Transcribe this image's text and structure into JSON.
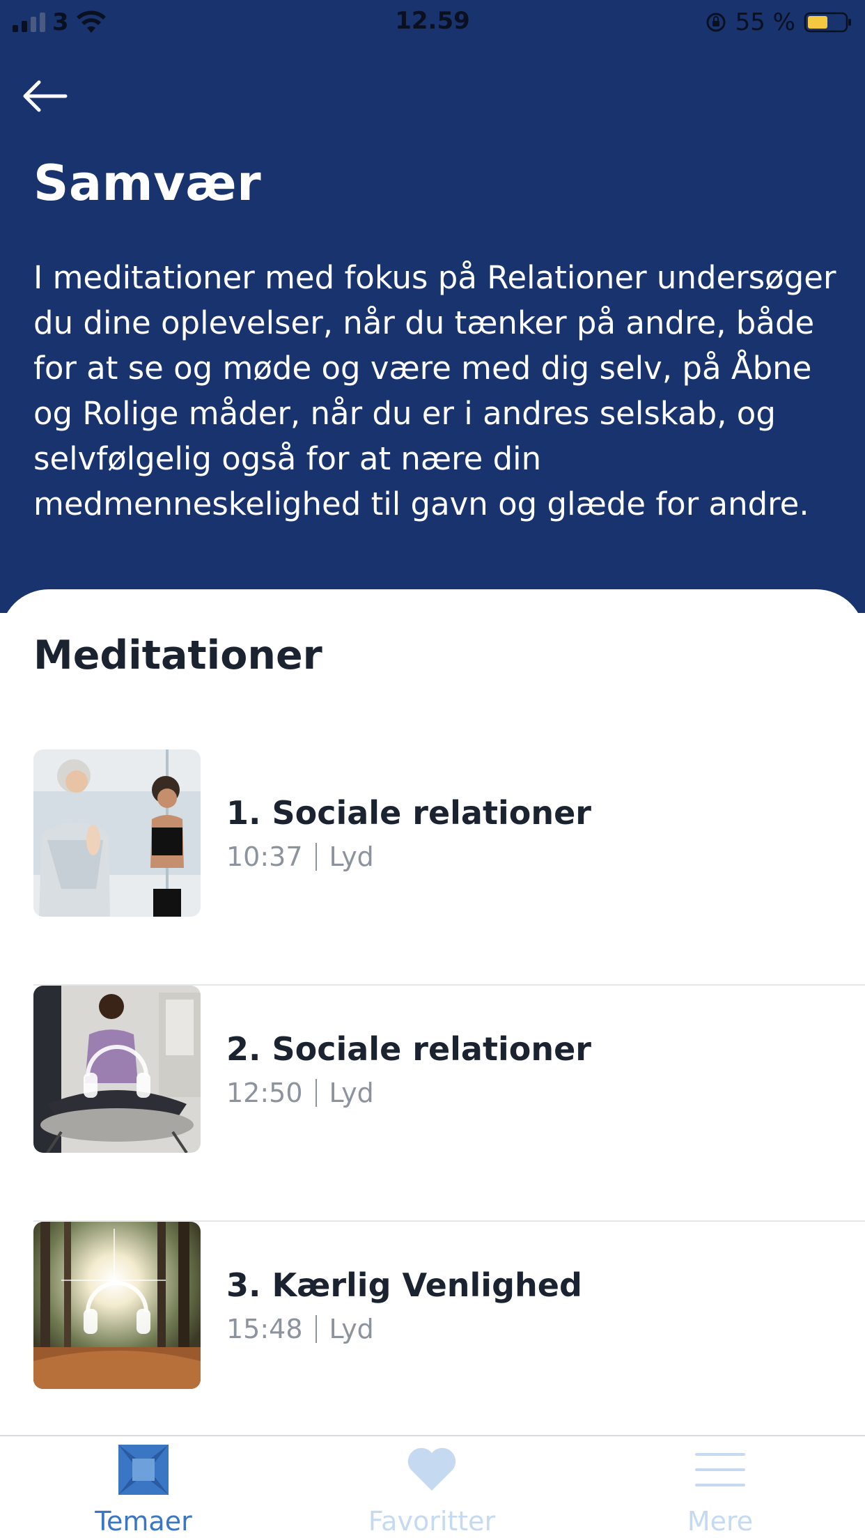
{
  "status_bar": {
    "carrier": "3",
    "time": "12.59",
    "battery_percent": "55 %"
  },
  "header": {
    "title": "Samvær",
    "description": "I meditationer med fokus på Relationer undersøger du dine oplevelser, når du tænker på andre, både for at se og møde og være med dig selv, på Åbne og Rolige måder, når du er i andres selskab, og selvfølgelig også for at nære din medmenneskelighed til gavn og glæde for andre."
  },
  "section": {
    "title": "Meditationer"
  },
  "meditations": [
    {
      "title": "1. Sociale relationer",
      "duration": "10:37",
      "type": "Lyd"
    },
    {
      "title": "2. Sociale relationer",
      "duration": "12:50",
      "type": "Lyd"
    },
    {
      "title": "3. Kærlig Venlighed",
      "duration": "15:48",
      "type": "Lyd"
    }
  ],
  "tabbar": {
    "tabs": [
      {
        "label": "Temaer",
        "icon": "themes-icon",
        "active": true
      },
      {
        "label": "Favoritter",
        "icon": "heart-icon",
        "active": false
      },
      {
        "label": "Mere",
        "icon": "menu-icon",
        "active": false
      }
    ]
  },
  "colors": {
    "header_bg": "#18336e",
    "active_tab": "#3a76c4",
    "inactive_tab": "#c5daf0"
  }
}
